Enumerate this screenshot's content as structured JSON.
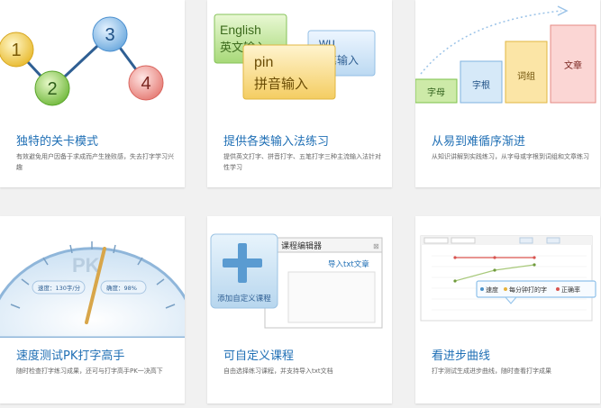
{
  "cards": [
    {
      "title": "独特的关卡模式",
      "desc": "有效避免用户因备于求成而产生挫败感，失去打字学习兴趣",
      "illus": {
        "nodes": [
          "1",
          "2",
          "3",
          "4"
        ]
      }
    },
    {
      "title": "提供各类输入法练习",
      "desc": "提供英文打字、拼音打字、五笔打字三种主流输入法针对性学习",
      "illus": {
        "english_card": [
          "English",
          "英文输入"
        ],
        "wu_card": [
          "wu",
          "笔输入"
        ],
        "pin_card": [
          "pin",
          "拼音输入"
        ]
      }
    },
    {
      "title": "从易到难循序渐进",
      "desc": "从知识讲解到实践练习，从字母或字根到词组和文章练习",
      "illus": {
        "steps": [
          "字母",
          "字根",
          "词组",
          "文章"
        ]
      }
    },
    {
      "title": "速度测试PK打字高手",
      "desc": "随时检查打字练习成果，还可与打字高手PK一决高下",
      "illus": {
        "pk": "PK",
        "speed": "速度：130字/分",
        "accuracy": "确度：98%"
      }
    },
    {
      "title": "可自定义课程",
      "desc": "自由选择练习课程，并支持导入txt文档",
      "illus": {
        "plus_label": "添加自定义课程",
        "editor_title": "课程编辑器",
        "import": "导入txt文章",
        "close": "⊠"
      }
    },
    {
      "title": "看进步曲线",
      "desc": "打字测试生成进步曲线，随时查看打字成果",
      "illus": {
        "legend": [
          "速度",
          "每分钟打的字",
          "正确率"
        ]
      }
    }
  ],
  "colors": {
    "title": "#1f6fb5",
    "desc": "#666666",
    "green": "#7cc24a",
    "yellow": "#f2c94c",
    "red": "#e9857f",
    "blue": "#4a90c8"
  }
}
